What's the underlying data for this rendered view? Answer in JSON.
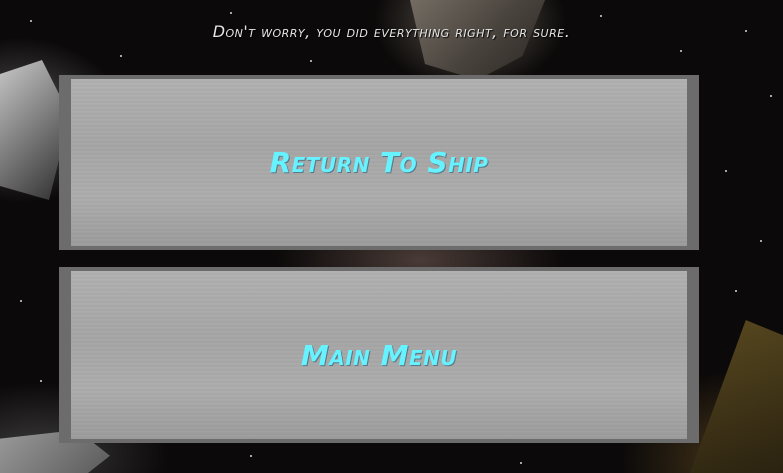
{
  "screen": {
    "message": "Don't worry, you did everything right, for sure."
  },
  "menu": {
    "return_to_ship": "Return To Ship",
    "main_menu": "Main Menu"
  },
  "colors": {
    "button_text": "#66f2ff",
    "button_face": "#b0b0b0",
    "button_border": "#6c6c6c",
    "message_text": "#e6e6e6"
  }
}
